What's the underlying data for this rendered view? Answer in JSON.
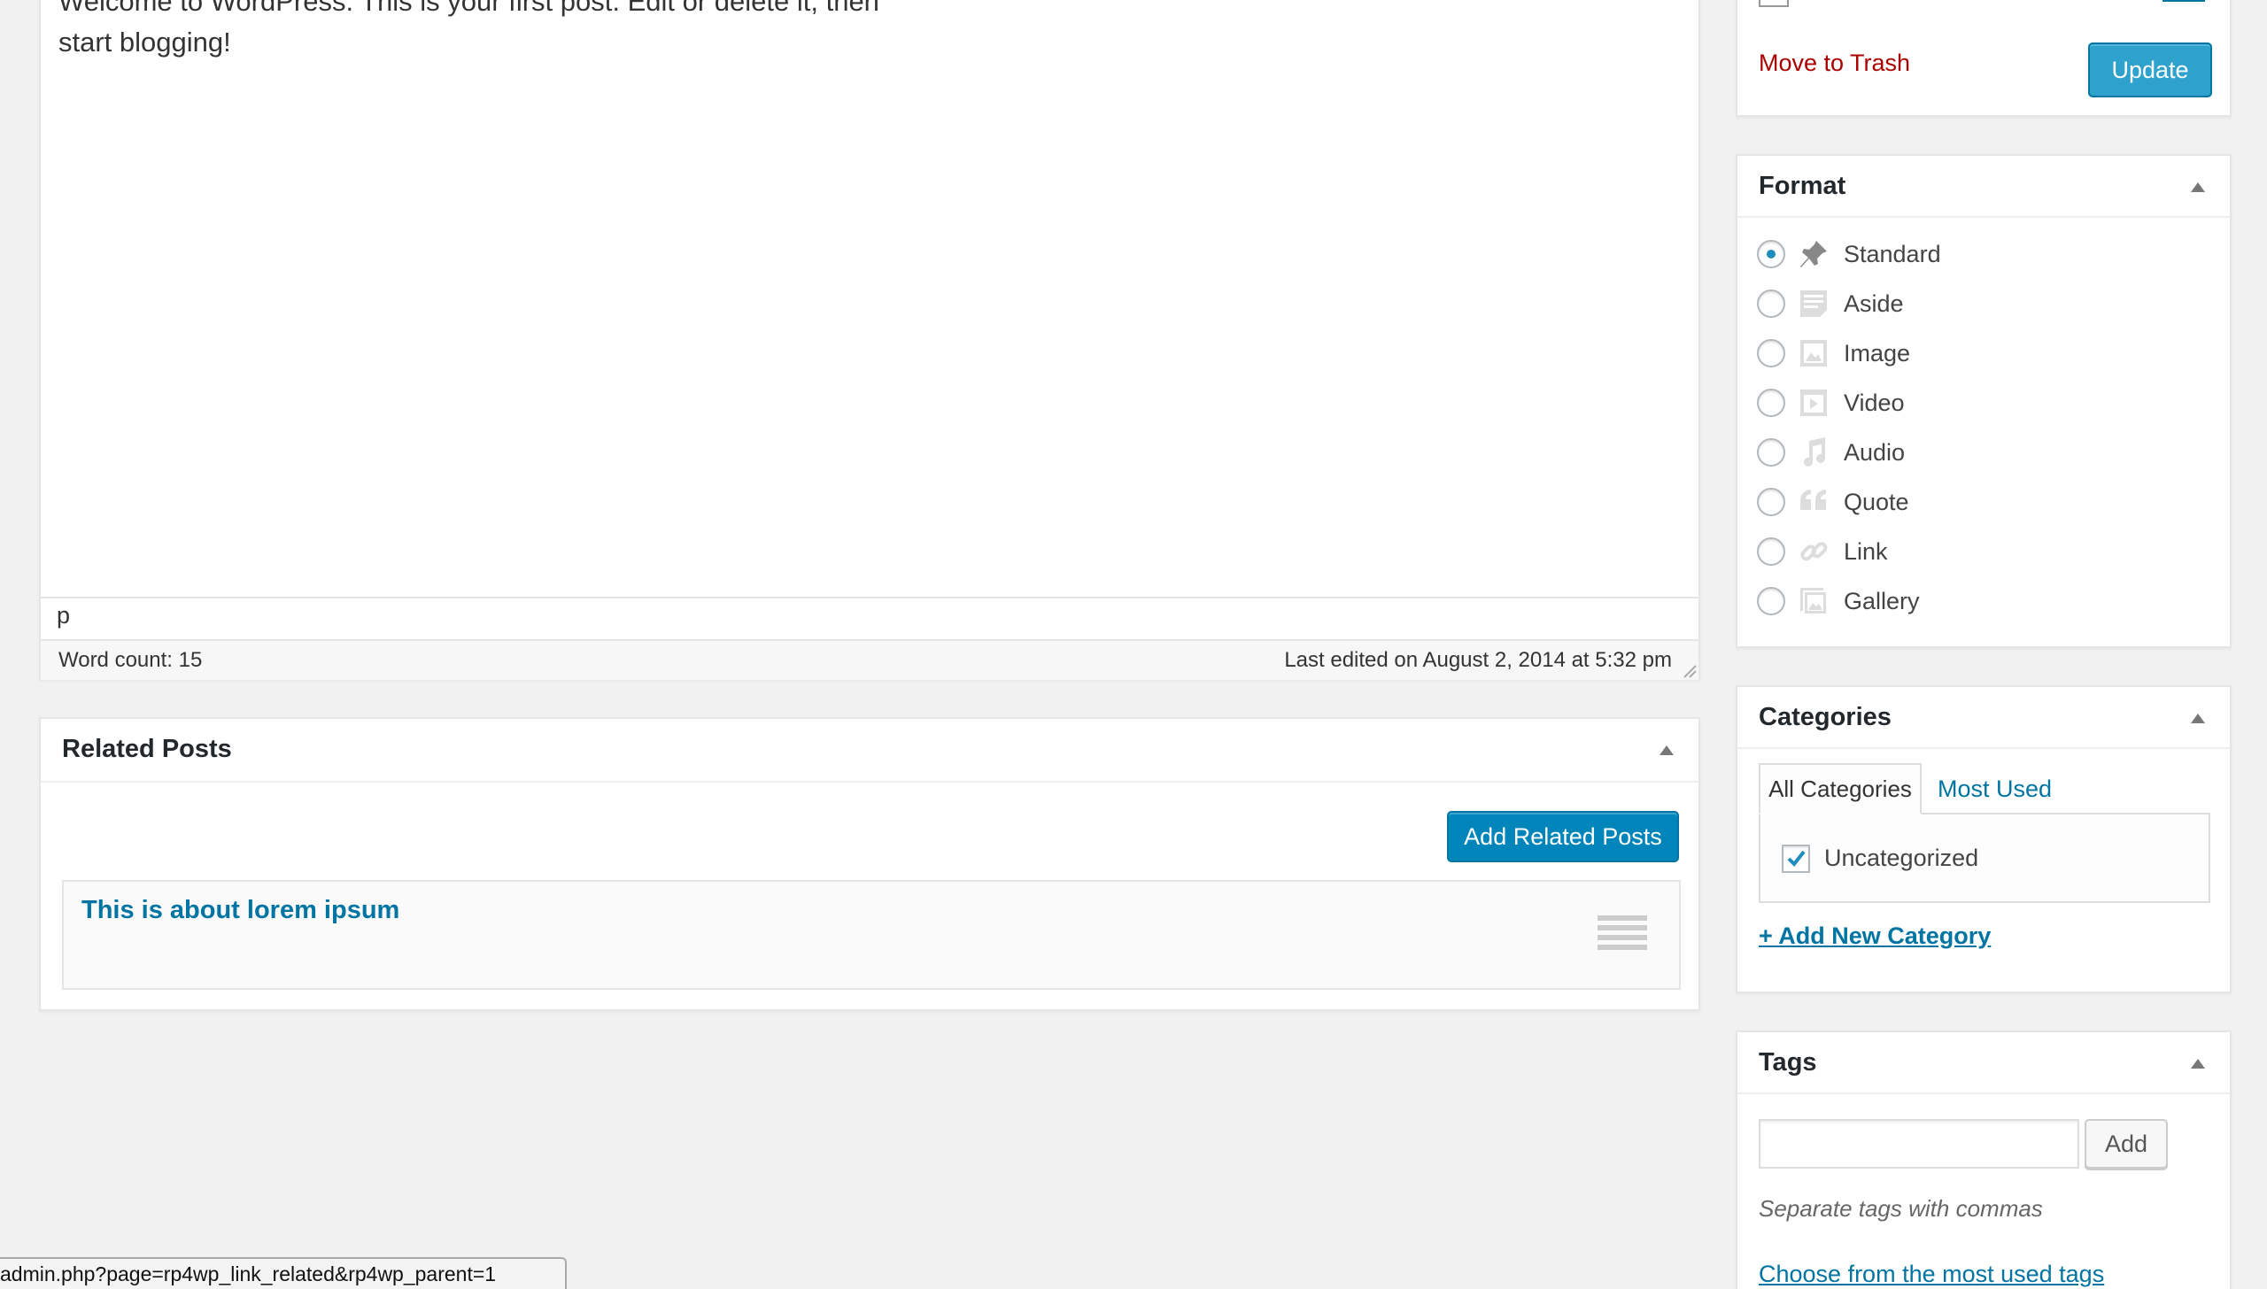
{
  "editor": {
    "content_line1": "Welcome to WordPress. This is your first post. Edit or delete it, then",
    "content_line2": "start blogging!",
    "path": "p",
    "word_count": "Word count: 15",
    "last_edited": "Last edited on August 2, 2014 at 5:32 pm"
  },
  "related_posts": {
    "title": "Related Posts",
    "add_button": "Add Related Posts",
    "items": [
      {
        "title": "This is about lorem ipsum"
      }
    ]
  },
  "publish": {
    "trash_link": "Move to Trash",
    "update_button": "Update"
  },
  "format": {
    "title": "Format",
    "options": [
      {
        "label": "Standard",
        "icon": "pin-icon",
        "checked": true
      },
      {
        "label": "Aside",
        "icon": "aside-icon",
        "checked": false
      },
      {
        "label": "Image",
        "icon": "image-icon",
        "checked": false
      },
      {
        "label": "Video",
        "icon": "video-icon",
        "checked": false
      },
      {
        "label": "Audio",
        "icon": "audio-icon",
        "checked": false
      },
      {
        "label": "Quote",
        "icon": "quote-icon",
        "checked": false
      },
      {
        "label": "Link",
        "icon": "link-icon",
        "checked": false
      },
      {
        "label": "Gallery",
        "icon": "gallery-icon",
        "checked": false
      }
    ]
  },
  "categories": {
    "title": "Categories",
    "tab_all": "All Categories",
    "tab_most_used": "Most Used",
    "items": [
      {
        "label": "Uncategorized",
        "checked": true
      }
    ],
    "add_new": "+ Add New Category"
  },
  "tags": {
    "title": "Tags",
    "input_value": "",
    "add_button": "Add",
    "help": "Separate tags with commas",
    "choose_link": "Choose from the most used tags"
  },
  "status_bar": {
    "url": "admin.php?page=rp4wp_link_related&rp4wp_parent=1"
  },
  "colors": {
    "link": "#0074a2",
    "primary_button": "#2ea2cc",
    "trash": "#a00",
    "background": "#f1f1f1"
  }
}
